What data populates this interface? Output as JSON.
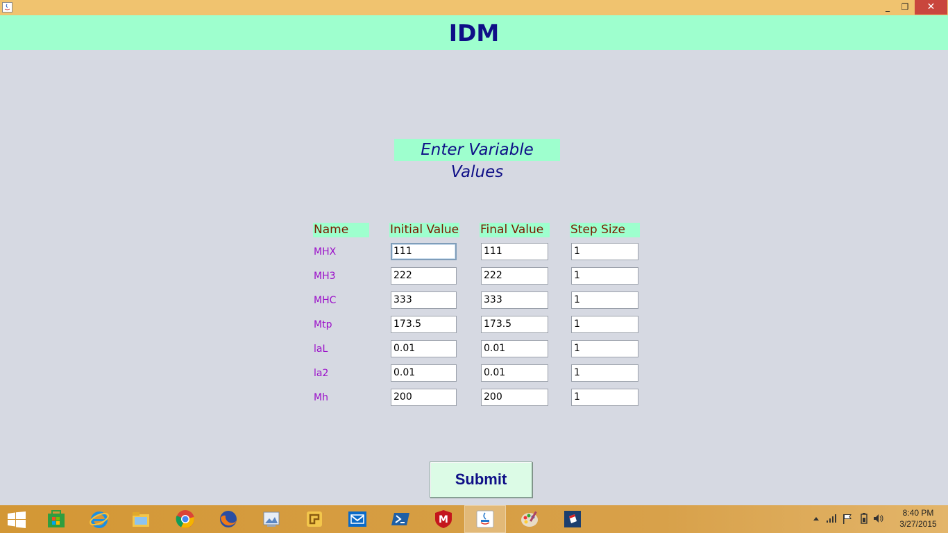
{
  "window": {
    "title": "IDM",
    "minimize_glyph": "_",
    "maximize_glyph": "❐",
    "close_glyph": "✕"
  },
  "form": {
    "heading": "Enter Variable Values",
    "columns": [
      "Name",
      "Initial Value",
      "Final Value",
      "Step Size"
    ],
    "rows": [
      {
        "name": "MHX",
        "initial": "111",
        "final": "111",
        "step": "1"
      },
      {
        "name": "MH3",
        "initial": "222",
        "final": "222",
        "step": "1"
      },
      {
        "name": "MHC",
        "initial": "333",
        "final": "333",
        "step": "1"
      },
      {
        "name": "Mtp",
        "initial": "173.5",
        "final": "173.5",
        "step": "1"
      },
      {
        "name": "laL",
        "initial": "0.01",
        "final": "0.01",
        "step": "1"
      },
      {
        "name": "la2",
        "initial": "0.01",
        "final": "0.01",
        "step": "1"
      },
      {
        "name": "Mh",
        "initial": "200",
        "final": "200",
        "step": "1"
      }
    ],
    "submit_label": "Submit"
  },
  "taskbar": {
    "apps": [
      "start-button",
      "store-icon",
      "internet-explorer-icon",
      "file-explorer-icon",
      "chrome-icon",
      "firefox-icon",
      "photo-viewer-icon",
      "puzzle-app-icon",
      "mail-icon",
      "powershell-icon",
      "mcafee-icon",
      "java-icon",
      "paint-icon",
      "app-red-icon"
    ],
    "time": "8:40 PM",
    "date": "3/27/2015"
  },
  "colors": {
    "accent": "#9effce",
    "title_text": "#0f0f87",
    "label_text": "#9b0fc9",
    "header_text": "#7a1b00",
    "titlebar": "#f0c36f",
    "taskbar": "#d49a3b"
  }
}
